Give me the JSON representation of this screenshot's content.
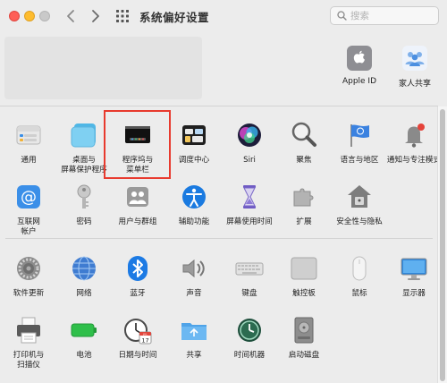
{
  "window": {
    "title": "系统偏好设置"
  },
  "search": {
    "placeholder": "搜索"
  },
  "account": {
    "items": [
      {
        "label": "Apple ID"
      },
      {
        "label": "家人共享"
      }
    ]
  },
  "sections": {
    "row1": [
      {
        "label": "通用"
      },
      {
        "label": "桌面与\n屏幕保护程序"
      },
      {
        "label": "程序坞与\n菜单栏"
      },
      {
        "label": "调度中心"
      },
      {
        "label": "Siri"
      },
      {
        "label": "聚焦"
      },
      {
        "label": "语言与地区"
      },
      {
        "label": "通知与专注模式"
      }
    ],
    "row2": [
      {
        "label": "互联网\n帐户"
      },
      {
        "label": "密码"
      },
      {
        "label": "用户与群组"
      },
      {
        "label": "辅助功能"
      },
      {
        "label": "屏幕使用时间"
      },
      {
        "label": "扩展"
      },
      {
        "label": "安全性与隐私"
      }
    ],
    "row3": [
      {
        "label": "软件更新"
      },
      {
        "label": "网络"
      },
      {
        "label": "蓝牙"
      },
      {
        "label": "声音"
      },
      {
        "label": "键盘"
      },
      {
        "label": "触控板"
      },
      {
        "label": "鼠标"
      },
      {
        "label": "显示器"
      }
    ],
    "row4": [
      {
        "label": "打印机与\n扫描仪"
      },
      {
        "label": "电池"
      },
      {
        "label": "日期与时间"
      },
      {
        "label": "共享"
      },
      {
        "label": "时间机器"
      },
      {
        "label": "启动磁盘"
      }
    ]
  },
  "date_icon": {
    "month": "JUL",
    "day": "17"
  },
  "highlight_color": "#e83a2e"
}
